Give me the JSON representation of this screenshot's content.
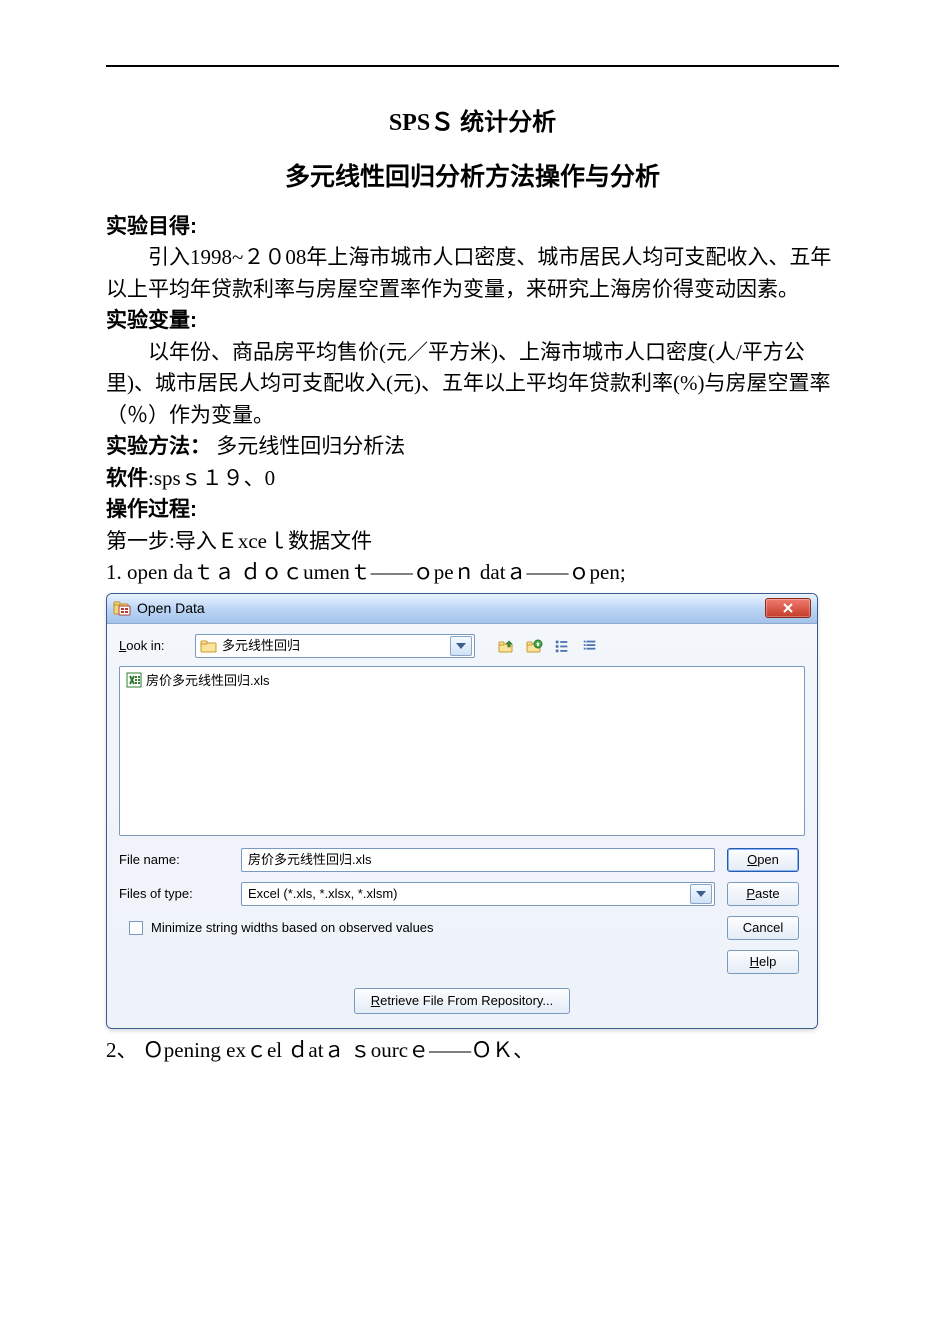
{
  "doc": {
    "title_main": "SPSＳ 统计分析",
    "title_sub": "多元线性回归分析方法操作与分析",
    "labels": {
      "aim": "实验目得:",
      "vars": "实验变量:",
      "method_label": "实验方法：",
      "method_value": "多元线性回归分析法",
      "software_label": "软件",
      "software_value": ":spsｓ１９、0",
      "process": "操作过程:"
    },
    "para_aim": "引入1998~２０08年上海市城市人口密度、城市居民人均可支配收入、五年以上平均年贷款利率与房屋空置率作为变量，来研究上海房价得变动因素。",
    "para_vars": "以年份、商品房平均售价(元／平方米)、上海市城市人口密度(人/平方公里)、城市居民人均可支配收入(元)、五年以上平均年贷款利率(%)与房屋空置率（％）作为变量。",
    "step1": "第一步:导入Ｅxceｌ数据文件",
    "step1_cmd": "1. open daｔａ ｄｏｃumenｔ——ｏpeｎ datａ——ｏpen;",
    "step2": "2、 Ｏpening exｃel  ｄatａ  ｓourcｅ——ＯＫ、"
  },
  "dialog": {
    "title": "Open Data",
    "lookin_label_pre": "L",
    "lookin_label_post": "ook in:",
    "lookin_value": "多元线性回归",
    "file_list_item": "房价多元线性回归.xls",
    "filename_label": "File name:",
    "filename_value": "房价多元线性回归.xls",
    "filetype_label": "Files of type:",
    "filetype_value": "Excel (*.xls, *.xlsx, *.xlsm)",
    "minimize_label": "Minimize string widths based on observed values",
    "buttons": {
      "open_pre": "O",
      "open_post": "pen",
      "paste_pre": "P",
      "paste_post": "aste",
      "cancel": "Cancel",
      "help_pre": "H",
      "help_post": "elp",
      "retrieve_pre": "R",
      "retrieve_post": "etrieve File From Repository..."
    }
  }
}
